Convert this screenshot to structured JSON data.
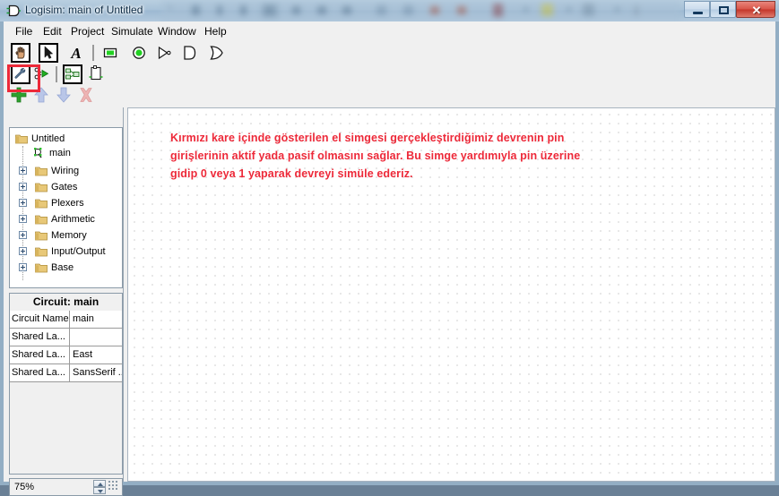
{
  "window": {
    "title": "Logisim: main of Untitled",
    "icon": "logisim-gate-icon",
    "controls": {
      "minimize": "Minimize",
      "maximize": "Maximize",
      "close": "Close",
      "close_glyph": "✕"
    }
  },
  "menubar": {
    "items": [
      {
        "label": "File"
      },
      {
        "label": "Edit"
      },
      {
        "label": "Project"
      },
      {
        "label": "Simulate"
      },
      {
        "label": "Window"
      },
      {
        "label": "Help"
      }
    ]
  },
  "toolbar": {
    "row1": [
      {
        "name": "poke-tool",
        "title": "Poke Tool",
        "selected": true
      },
      {
        "name": "select-tool",
        "title": "Select Tool",
        "selected": false
      },
      {
        "name": "text-tool",
        "title": "Text Tool",
        "label": "A"
      },
      {
        "name": "input-pin-tool",
        "title": "Input Pin"
      },
      {
        "name": "output-pin-tool",
        "title": "Output Pin"
      },
      {
        "name": "not-gate-tool",
        "title": "NOT Gate"
      },
      {
        "name": "and-gate-tool",
        "title": "AND Gate"
      },
      {
        "name": "or-gate-tool",
        "title": "OR Gate"
      }
    ],
    "row2": [
      {
        "name": "edit-tool",
        "title": "Edit Circuit"
      },
      {
        "name": "simulate-tool",
        "title": "Simulate"
      },
      {
        "name": "subcircuit-tool",
        "title": "Add Circuit"
      },
      {
        "name": "pin-layout-tool",
        "title": "Pin Layout"
      }
    ],
    "row3": [
      {
        "name": "add-button",
        "title": "Add",
        "enabled": true
      },
      {
        "name": "move-up-button",
        "title": "Move Up",
        "enabled": false
      },
      {
        "name": "move-down-button",
        "title": "Move Down",
        "enabled": false
      },
      {
        "name": "delete-button",
        "title": "Delete",
        "enabled": false
      }
    ]
  },
  "explorer": {
    "root": {
      "label": "Untitled",
      "icon": "folder-icon"
    },
    "circuit": {
      "label": "main",
      "icon": "circuit-icon"
    },
    "libraries": [
      {
        "label": "Wiring"
      },
      {
        "label": "Gates"
      },
      {
        "label": "Plexers"
      },
      {
        "label": "Arithmetic"
      },
      {
        "label": "Memory"
      },
      {
        "label": "Input/Output"
      },
      {
        "label": "Base"
      }
    ]
  },
  "attributes": {
    "header": "Circuit: main",
    "rows": [
      {
        "key": "Circuit Name",
        "value": "main"
      },
      {
        "key": "Shared La...",
        "value": ""
      },
      {
        "key": "Shared La...",
        "value": "East"
      },
      {
        "key": "Shared La...",
        "value": "SansSerif ..."
      }
    ]
  },
  "statusbar": {
    "zoom": "75%",
    "spinner_up": "increase-zoom",
    "spinner_down": "decrease-zoom",
    "grip": "resize-grip"
  },
  "canvas": {
    "annotation_color": "#ED2939",
    "annotation_lines": [
      "Kırmızı kare içinde gösterilen el simgesi gerçekleştirdiğimiz devrenin pin",
      "girişlerinin aktif yada pasif olmasını sağlar. Bu simge yardımıyla pin üzerine",
      "gidip 0 veya 1 yaparak devreyi simüle ederiz."
    ],
    "highlight": "red-rectangle-around-poke-tool"
  }
}
